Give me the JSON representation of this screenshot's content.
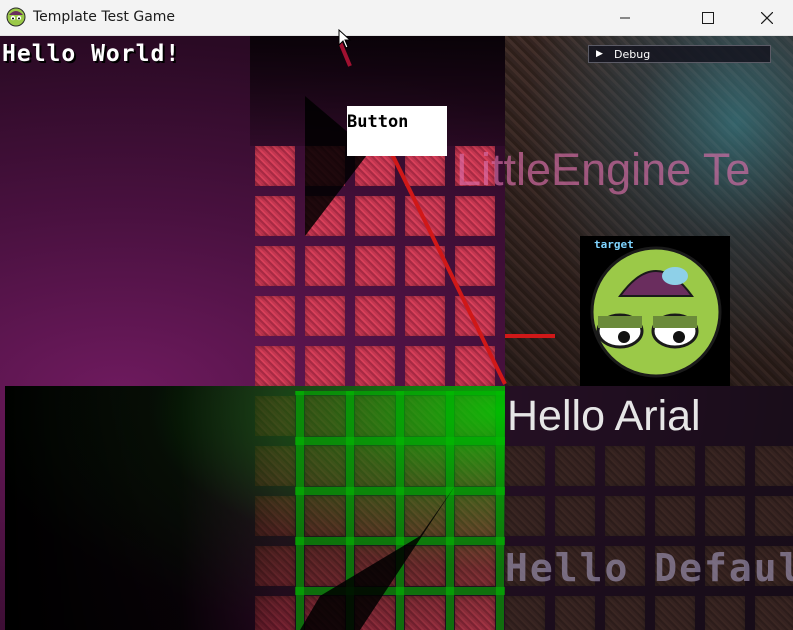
{
  "window": {
    "title": "Template Test Game",
    "app_icon": "zombie-face-icon",
    "controls": [
      "minimize-icon",
      "maximize-icon",
      "close-icon"
    ]
  },
  "hud": {
    "hello_world": "Hello World!",
    "debug_label": "Debug",
    "debug_arrow": "▶"
  },
  "button": {
    "label": "Button"
  },
  "texts": {
    "engine_title": "LittleEngine Te",
    "hello_arial": "Hello Arial",
    "hello_default": "Hello Default"
  },
  "sprite": {
    "label": "target"
  },
  "colors": {
    "line_red": "#d01818",
    "grid_green": "#00c800",
    "title_bar": "#f3f3f3"
  }
}
